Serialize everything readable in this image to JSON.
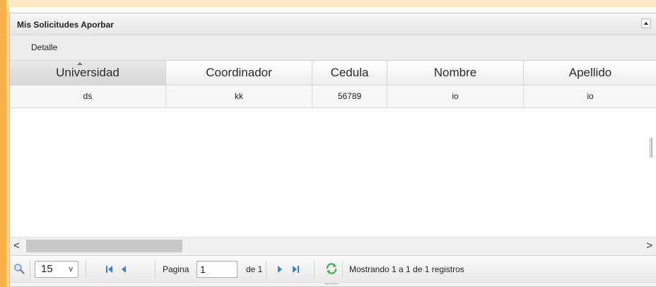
{
  "grid": {
    "caption": "Mis Solicitudes Aporbar",
    "toolbar_detalle": "Detalle",
    "columns": [
      "Universidad",
      "Coordinador",
      "Cedula",
      "Nombre",
      "Apellido"
    ],
    "sorted_column": "Universidad",
    "rows": [
      [
        "ds",
        "kk",
        "56789",
        "io",
        "io"
      ]
    ]
  },
  "pager": {
    "rows_per_page": "15",
    "pagina_label": "Pagina",
    "current_page": "1",
    "de_label": "de 1",
    "status": "Mostrando 1 a 1 de 1 registros"
  },
  "scroll": {
    "left_arrow": "<",
    "right_arrow": ">",
    "rows_chevron": "v"
  },
  "icons": {
    "search": "search-icon",
    "first": "first-page-icon",
    "prev": "prev-page-icon",
    "next": "next-page-icon",
    "last": "last-page-icon",
    "refresh": "refresh-icon",
    "collapse": "collapse-icon"
  },
  "colors": {
    "accent_orange": "#f5b04a",
    "nav_blue": "#3a7fd5",
    "refresh_green": "#4caf50"
  }
}
